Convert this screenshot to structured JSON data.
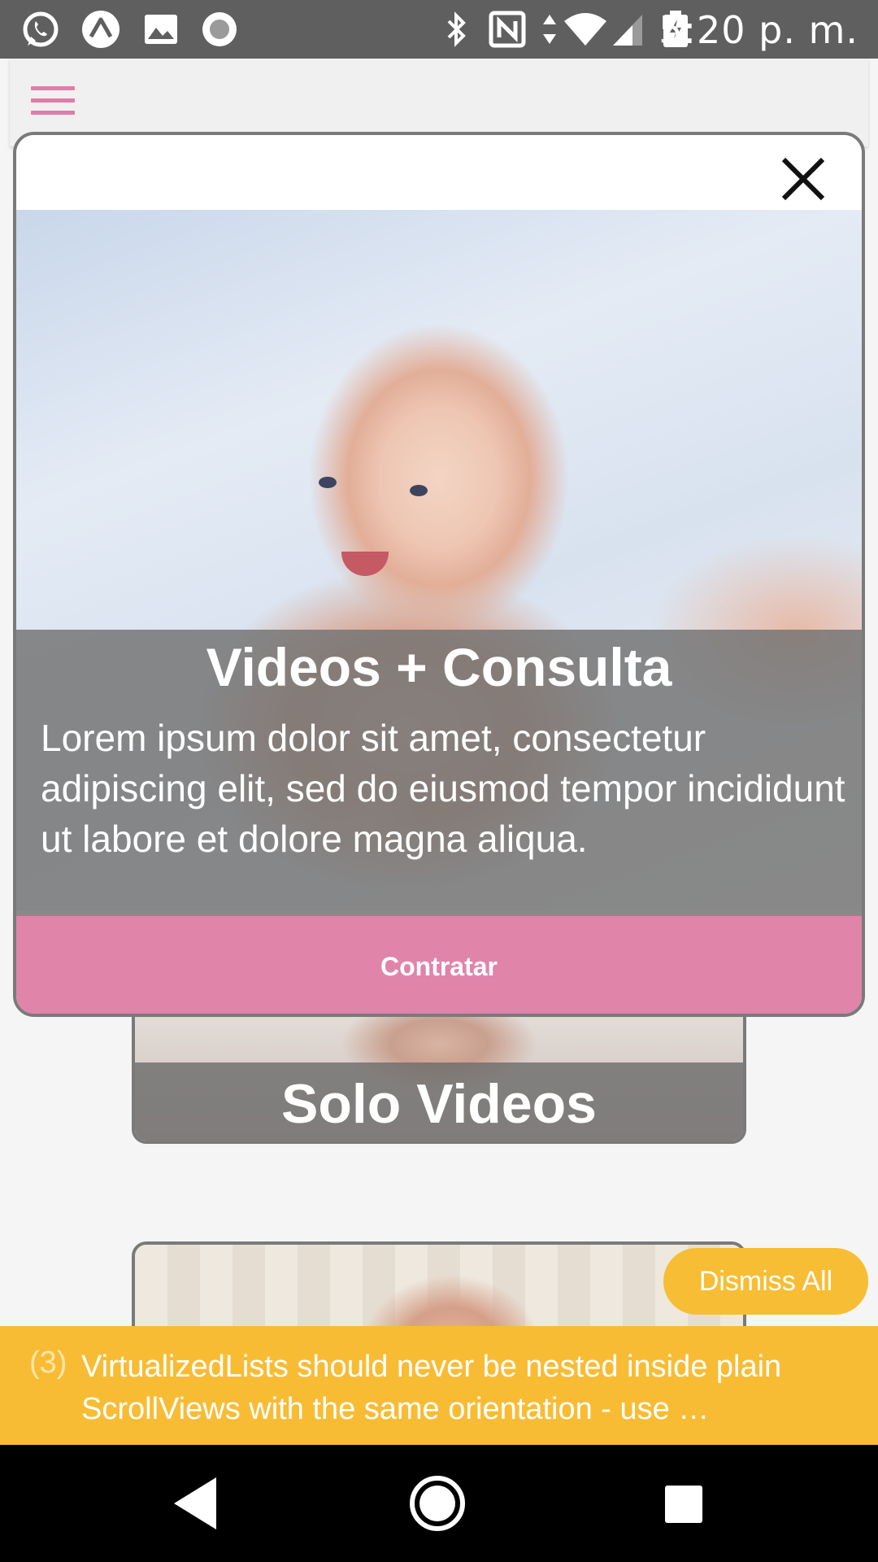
{
  "status_bar": {
    "time": "5:20 p. m.",
    "left_icons": [
      "whatsapp-icon",
      "expo-icon",
      "gallery-icon",
      "record-icon"
    ],
    "right_icons": [
      "bluetooth-icon",
      "nfc-icon",
      "data-arrows-icon",
      "wifi-icon",
      "signal-icon",
      "battery-charging-icon"
    ]
  },
  "header": {
    "menu_icon": "hamburger-menu-icon",
    "accent_color": "#e07ca8"
  },
  "modal": {
    "title": "Videos + Consulta",
    "description": "Lorem ipsum dolor sit amet, consectetur adipiscing elit, sed do eiusmod tempor incididunt ut labore et dolore magna aliqua.",
    "button_label": "Contratar",
    "button_color": "#e084aa",
    "close_icon": "close-icon"
  },
  "background_cards": [
    {
      "title": "Solo Videos"
    },
    {
      "title": ""
    }
  ],
  "warning": {
    "count": "(3)",
    "message": "VirtualizedLists should never be nested inside plain ScrollViews with the same orientation - use …",
    "dismiss_label": "Dismiss All",
    "color": "#f8bc34"
  },
  "nav_bar": {
    "icons": [
      "back-icon",
      "home-icon",
      "recents-icon"
    ]
  }
}
